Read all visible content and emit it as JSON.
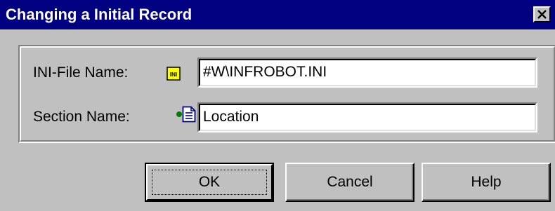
{
  "window": {
    "title": "Changing a Initial Record",
    "close_label": "Close"
  },
  "form": {
    "ini_file_label": "INI-File Name:",
    "ini_file_value": "#W\\INFROBOT.INI",
    "ini_icon_text": "INI",
    "section_label": "Section Name:",
    "section_value": "Location"
  },
  "buttons": {
    "ok": "OK",
    "cancel": "Cancel",
    "help": "Help"
  },
  "colors": {
    "titlebar": "#000080",
    "face": "#c0c0c0",
    "ini_icon": "#ffff00",
    "status_dot": "#008000"
  },
  "icons": {
    "close": "close-icon",
    "ini_file": "ini-file-icon",
    "section": "section-document-icon"
  }
}
